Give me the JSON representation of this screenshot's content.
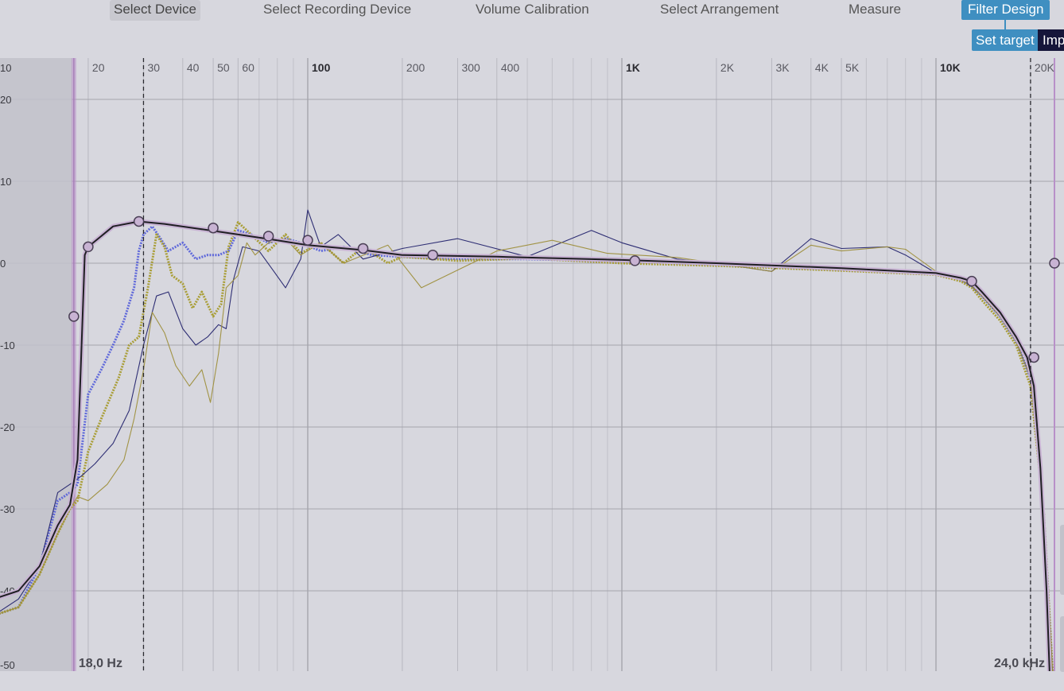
{
  "nav": {
    "tabs": [
      {
        "label": "Select Device",
        "state": "selected"
      },
      {
        "label": "Select Recording Device",
        "state": "normal"
      },
      {
        "label": "Volume Calibration",
        "state": "normal"
      },
      {
        "label": "Select Arrangement",
        "state": "normal"
      },
      {
        "label": "Measure",
        "state": "normal"
      },
      {
        "label": "Filter Design",
        "state": "active"
      }
    ],
    "subtabs": [
      {
        "label": "Set target",
        "state": "active"
      },
      {
        "label": "Imp",
        "state": "normal"
      }
    ]
  },
  "colors": {
    "background": "#d7d7de",
    "accent": "#3f8fc1",
    "target_curve": "#1f1f23",
    "target_curve_fill": "#c8b3d3",
    "series_blue": "#5a63d9",
    "series_olive": "#a79b2d",
    "series_navy": "#25256e",
    "series_olive_thin": "#9e8f3c",
    "excluded_region": "#c2c2ca",
    "cutoff_marker": "#b890c8"
  },
  "chart_data": {
    "type": "line",
    "x_scale": "log",
    "xlim": [
      10,
      25000
    ],
    "ylim": [
      -50,
      20
    ],
    "grid": true,
    "x_major_ticks": [
      {
        "value": 20,
        "label": "20"
      },
      {
        "value": 30,
        "label": "30"
      },
      {
        "value": 40,
        "label": "40"
      },
      {
        "value": 50,
        "label": "50"
      },
      {
        "value": 60,
        "label": "60"
      },
      {
        "value": 100,
        "label": "100"
      },
      {
        "value": 200,
        "label": "200"
      },
      {
        "value": 300,
        "label": "300"
      },
      {
        "value": 400,
        "label": "400"
      },
      {
        "value": 1000,
        "label": "1K"
      },
      {
        "value": 2000,
        "label": "2K"
      },
      {
        "value": 3000,
        "label": "3K"
      },
      {
        "value": 4000,
        "label": "4K"
      },
      {
        "value": 5000,
        "label": "5K"
      },
      {
        "value": 10000,
        "label": "10K"
      },
      {
        "value": 20000,
        "label": "20K"
      }
    ],
    "x_minor_ticks": [
      70,
      80,
      90,
      500,
      600,
      700,
      800,
      900,
      6000,
      7000,
      8000,
      9000
    ],
    "y_ticks": [
      {
        "value": 30,
        "label": "10"
      },
      {
        "value": 20,
        "label": "20"
      },
      {
        "value": 10,
        "label": "10"
      },
      {
        "value": 0,
        "label": "0"
      },
      {
        "value": -10,
        "label": "-10"
      },
      {
        "value": -20,
        "label": "-20"
      },
      {
        "value": -30,
        "label": "-30"
      },
      {
        "value": -40,
        "label": "-40"
      },
      {
        "value": -50,
        "label": "-50"
      }
    ],
    "low_limit": {
      "value": 18,
      "label": "18,0 Hz"
    },
    "high_limit": {
      "value": 24000,
      "label": "24,0 kHz"
    },
    "dashed_markers": [
      30,
      20000
    ],
    "target_curve": [
      [
        10,
        -41
      ],
      [
        12,
        -40
      ],
      [
        14,
        -37
      ],
      [
        16,
        -32
      ],
      [
        17.5,
        -29.5
      ],
      [
        18.5,
        -24
      ],
      [
        19.5,
        1
      ],
      [
        20,
        2
      ],
      [
        24,
        4.5
      ],
      [
        29,
        5.1
      ],
      [
        35,
        4.8
      ],
      [
        45,
        4.2
      ],
      [
        60,
        3.5
      ],
      [
        80,
        2.8
      ],
      [
        100,
        2.2
      ],
      [
        150,
        1.6
      ],
      [
        200,
        1.0
      ],
      [
        400,
        0.8
      ],
      [
        1000,
        0.4
      ],
      [
        2000,
        0
      ],
      [
        5000,
        -0.6
      ],
      [
        10000,
        -1.2
      ],
      [
        12000,
        -1.8
      ],
      [
        13000,
        -2.2
      ],
      [
        14000,
        -3.5
      ],
      [
        16000,
        -6
      ],
      [
        18000,
        -9
      ],
      [
        19500,
        -11.5
      ],
      [
        20500,
        -15
      ],
      [
        21500,
        -25
      ],
      [
        22500,
        -40
      ],
      [
        23000,
        -50
      ]
    ],
    "target_points": [
      [
        18,
        -6.5
      ],
      [
        20,
        2
      ],
      [
        29,
        5.1
      ],
      [
        50,
        4.3
      ],
      [
        75,
        3.3
      ],
      [
        100,
        2.8
      ],
      [
        150,
        1.8
      ],
      [
        250,
        1.0
      ],
      [
        1100,
        0.3
      ],
      [
        13000,
        -2.2
      ],
      [
        20500,
        -11.5
      ],
      [
        25000,
        0
      ]
    ],
    "series": [
      {
        "style": "dotted_blue",
        "points": [
          [
            10,
            -43
          ],
          [
            12,
            -42
          ],
          [
            14,
            -37
          ],
          [
            16,
            -29
          ],
          [
            17.5,
            -28
          ],
          [
            18.5,
            -27
          ],
          [
            20,
            -16
          ],
          [
            22,
            -13
          ],
          [
            24,
            -10
          ],
          [
            26,
            -7
          ],
          [
            28,
            -3
          ],
          [
            29,
            1.5
          ],
          [
            30,
            3.5
          ],
          [
            32,
            4.5
          ],
          [
            34,
            3
          ],
          [
            36,
            1.5
          ],
          [
            40,
            2.5
          ],
          [
            44,
            0.5
          ],
          [
            48,
            1
          ],
          [
            52,
            1
          ],
          [
            56,
            1.5
          ],
          [
            60,
            4
          ],
          [
            66,
            3.5
          ],
          [
            75,
            2.5
          ],
          [
            85,
            3
          ],
          [
            95,
            2.5
          ],
          [
            110,
            1.5
          ],
          [
            130,
            2.0
          ],
          [
            160,
            1.0
          ],
          [
            200,
            0.8
          ],
          [
            300,
            0.5
          ],
          [
            500,
            0.5
          ],
          [
            1000,
            0.2
          ],
          [
            2000,
            -0.2
          ],
          [
            5000,
            -0.8
          ],
          [
            10000,
            -1.3
          ],
          [
            12000,
            -2
          ],
          [
            13000,
            -2.8
          ],
          [
            14000,
            -4
          ],
          [
            16000,
            -6.5
          ],
          [
            18000,
            -9.5
          ],
          [
            20000,
            -14
          ],
          [
            22000,
            -30
          ],
          [
            23500,
            -50
          ]
        ]
      },
      {
        "style": "dotted_olive",
        "points": [
          [
            10,
            -43
          ],
          [
            12,
            -42
          ],
          [
            14,
            -38
          ],
          [
            16,
            -33
          ],
          [
            17.5,
            -30
          ],
          [
            18.5,
            -29
          ],
          [
            20,
            -23
          ],
          [
            22,
            -19
          ],
          [
            25,
            -14
          ],
          [
            27,
            -10
          ],
          [
            29,
            -9
          ],
          [
            31,
            -3
          ],
          [
            33,
            3.5
          ],
          [
            35,
            2
          ],
          [
            37,
            -1.5
          ],
          [
            40,
            -2.5
          ],
          [
            43,
            -5.5
          ],
          [
            46,
            -3.5
          ],
          [
            50,
            -6.5
          ],
          [
            53,
            -5
          ],
          [
            56,
            2
          ],
          [
            60,
            5
          ],
          [
            66,
            3.5
          ],
          [
            75,
            1.5
          ],
          [
            85,
            3.5
          ],
          [
            95,
            1.2
          ],
          [
            110,
            2.5
          ],
          [
            130,
            0
          ],
          [
            150,
            2.0
          ],
          [
            180,
            0
          ],
          [
            200,
            0.8
          ],
          [
            300,
            0.3
          ],
          [
            500,
            0.6
          ],
          [
            1000,
            0
          ],
          [
            2000,
            -0.3
          ],
          [
            5000,
            -0.9
          ],
          [
            10000,
            -1.4
          ],
          [
            12000,
            -2.2
          ],
          [
            13000,
            -3
          ],
          [
            14000,
            -4.5
          ],
          [
            16000,
            -7
          ],
          [
            18000,
            -10
          ],
          [
            20000,
            -15
          ],
          [
            22000,
            -30
          ],
          [
            23500,
            -50
          ]
        ]
      },
      {
        "style": "thin_navy",
        "points": [
          [
            10,
            -43
          ],
          [
            12,
            -41
          ],
          [
            14,
            -37
          ],
          [
            16,
            -28
          ],
          [
            17.5,
            -27
          ],
          [
            19,
            -26
          ],
          [
            21,
            -24.5
          ],
          [
            24,
            -22
          ],
          [
            27,
            -18
          ],
          [
            30,
            -10
          ],
          [
            33,
            -4
          ],
          [
            36,
            -3.5
          ],
          [
            40,
            -8
          ],
          [
            44,
            -10
          ],
          [
            48,
            -9
          ],
          [
            52,
            -7.5
          ],
          [
            55,
            -8
          ],
          [
            58,
            -2
          ],
          [
            62,
            2
          ],
          [
            70,
            1.5
          ],
          [
            78,
            -1
          ],
          [
            85,
            -3
          ],
          [
            95,
            0.5
          ],
          [
            100,
            6.5
          ],
          [
            110,
            2
          ],
          [
            125,
            3.5
          ],
          [
            150,
            0.5
          ],
          [
            200,
            1.8
          ],
          [
            300,
            3.0
          ],
          [
            500,
            0.8
          ],
          [
            800,
            4.0
          ],
          [
            1000,
            2.5
          ],
          [
            1500,
            0.5
          ],
          [
            2000,
            0
          ],
          [
            3000,
            -1.0
          ],
          [
            4000,
            3.0
          ],
          [
            5000,
            1.8
          ],
          [
            7000,
            2.0
          ],
          [
            8000,
            1.0
          ],
          [
            10000,
            -1.2
          ],
          [
            12000,
            -2
          ],
          [
            13000,
            -2.8
          ],
          [
            14000,
            -4
          ],
          [
            16000,
            -6.5
          ],
          [
            18000,
            -9.5
          ],
          [
            20000,
            -14
          ],
          [
            22000,
            -30
          ],
          [
            23500,
            -50
          ]
        ]
      },
      {
        "style": "thin_olive",
        "points": [
          [
            10,
            -43
          ],
          [
            12,
            -42
          ],
          [
            14,
            -38
          ],
          [
            16,
            -33
          ],
          [
            17.5,
            -30
          ],
          [
            18.5,
            -28.5
          ],
          [
            20,
            -29
          ],
          [
            23,
            -27
          ],
          [
            26,
            -24
          ],
          [
            28,
            -19
          ],
          [
            30,
            -13
          ],
          [
            32,
            -6
          ],
          [
            35,
            -8.5
          ],
          [
            38,
            -12.5
          ],
          [
            42,
            -15
          ],
          [
            46,
            -13
          ],
          [
            49,
            -17
          ],
          [
            52,
            -11
          ],
          [
            55,
            -3
          ],
          [
            60,
            -1.5
          ],
          [
            64,
            2.5
          ],
          [
            68,
            1
          ],
          [
            75,
            2.5
          ],
          [
            85,
            3
          ],
          [
            95,
            1
          ],
          [
            110,
            2.5
          ],
          [
            130,
            0
          ],
          [
            180,
            2.2
          ],
          [
            230,
            -3.0
          ],
          [
            400,
            1.5
          ],
          [
            600,
            2.8
          ],
          [
            900,
            1.2
          ],
          [
            1500,
            0.7
          ],
          [
            2000,
            0
          ],
          [
            3000,
            -1.0
          ],
          [
            4000,
            2.2
          ],
          [
            5000,
            1.5
          ],
          [
            7000,
            2.0
          ],
          [
            8000,
            1.7
          ],
          [
            10000,
            -1.0
          ],
          [
            12000,
            -2
          ],
          [
            13000,
            -2.8
          ],
          [
            14000,
            -4
          ],
          [
            16000,
            -6.5
          ],
          [
            18000,
            -9.5
          ],
          [
            20000,
            -14
          ],
          [
            22000,
            -30
          ],
          [
            23500,
            -50
          ]
        ]
      }
    ]
  }
}
